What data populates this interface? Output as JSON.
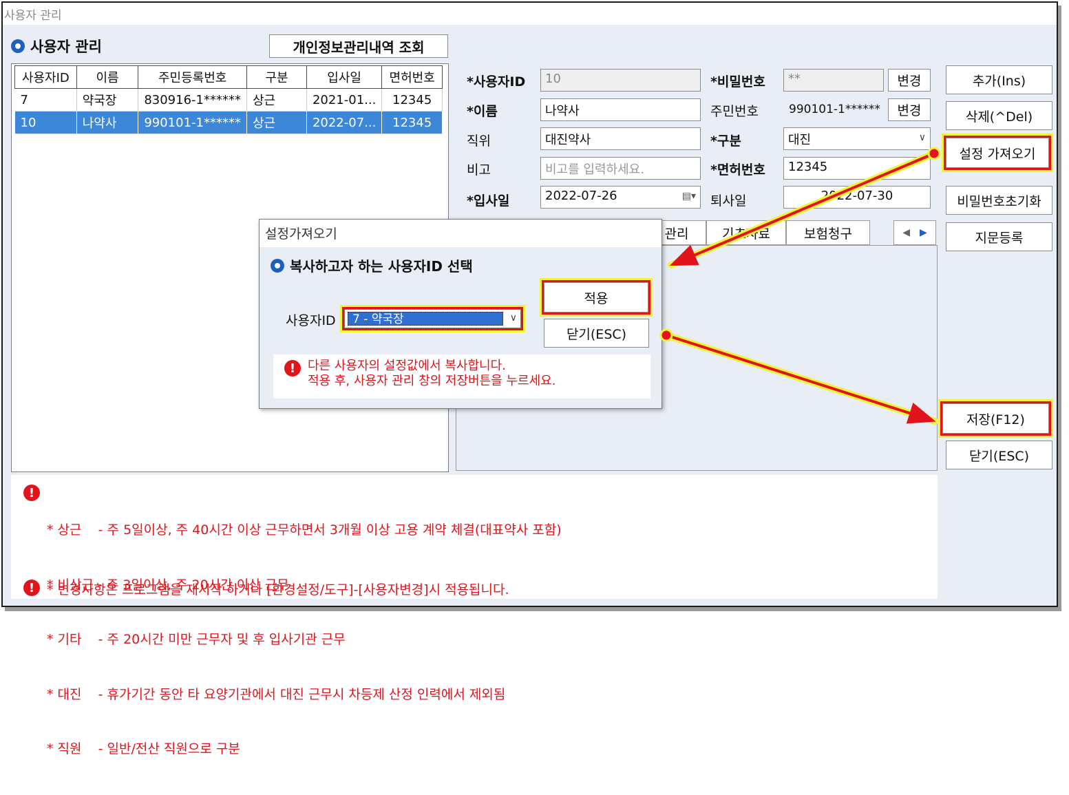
{
  "window": {
    "title": "사용자 관리"
  },
  "section": {
    "title": "사용자 관리",
    "privacy_button": "개인정보관리내역 조회"
  },
  "grid": {
    "headers": [
      "사용자ID",
      "이름",
      "주민등록번호",
      "구분",
      "입사일",
      "면허번호"
    ],
    "rows": [
      [
        "7",
        "약국장",
        "830916-1******",
        "상근",
        "2021-01...",
        "12345"
      ],
      [
        "10",
        "나약사",
        "990101-1******",
        "상근",
        "2022-07...",
        "12345"
      ]
    ],
    "selected_row": 1
  },
  "form": {
    "user_id_label": "*사용자ID",
    "user_id_value": "10",
    "password_label": "*비밀번호",
    "password_value": "**",
    "password_change": "변경",
    "name_label": "*이름",
    "name_value": "나약사",
    "rrn_label": "주민번호",
    "rrn_value": "990101-1******",
    "rrn_change": "변경",
    "position_label": "직위",
    "position_value": "대진약사",
    "type_label": "*구분",
    "type_value": "대진",
    "remark_label": "비고",
    "remark_placeholder": "비고를 입력하세요.",
    "license_label": "*면허번호",
    "license_value": "12345",
    "hire_label": "*입사일",
    "hire_value": "2022-07-26",
    "leave_label": "퇴사일",
    "leave_value": "2022-07-30"
  },
  "tabs": [
    "관리",
    "기초자료",
    "보험청구"
  ],
  "side_buttons": {
    "add": "추가(Ins)",
    "delete": "삭제(^Del)",
    "import_settings": "설정 가져오기",
    "reset_password": "비밀번호초기화",
    "fingerprint": "지문등록",
    "save": "저장(F12)",
    "close": "닫기(ESC)"
  },
  "dialog": {
    "title": "설정가져오기",
    "heading": "복사하고자 하는 사용자ID 선택",
    "user_id_label": "사용자ID",
    "user_id_selected": "7 - 약국장",
    "apply": "적용",
    "close": "닫기(ESC)",
    "info_line1": "다른 사용자의 설정값에서 복사합니다.",
    "info_line2": "적용 후, 사용자 관리 창의 저장버튼을 누르세요."
  },
  "notes": {
    "lines": [
      "* 상근    - 주 5일이상, 주 40시간 이상 근무하면서 3개월 이상 고용 계약 체결(대표약사 포함)",
      "* 비상근 - 주 3일이상, 주 20시간 이상 근무",
      "* 기타    - 주 20시간 미만 근무자 및 후 입사기관 근무",
      "* 대진    - 휴가기간 동안 타 요양기관에서 대진 근무시 차등제 산정 인력에서 제외됨",
      "* 직원    - 일반/전산 직원으로 구분"
    ],
    "bottom": "* 변경사항은 프로그램을 재시작 하거나 [환경설정/도구]-[사용자변경]시 적용됩니다."
  },
  "colors": {
    "accent_blue": "#1f5fbf",
    "selection": "#3d87d8",
    "warning_red": "#e0141a",
    "highlight_yellow": "#f3f23b"
  }
}
